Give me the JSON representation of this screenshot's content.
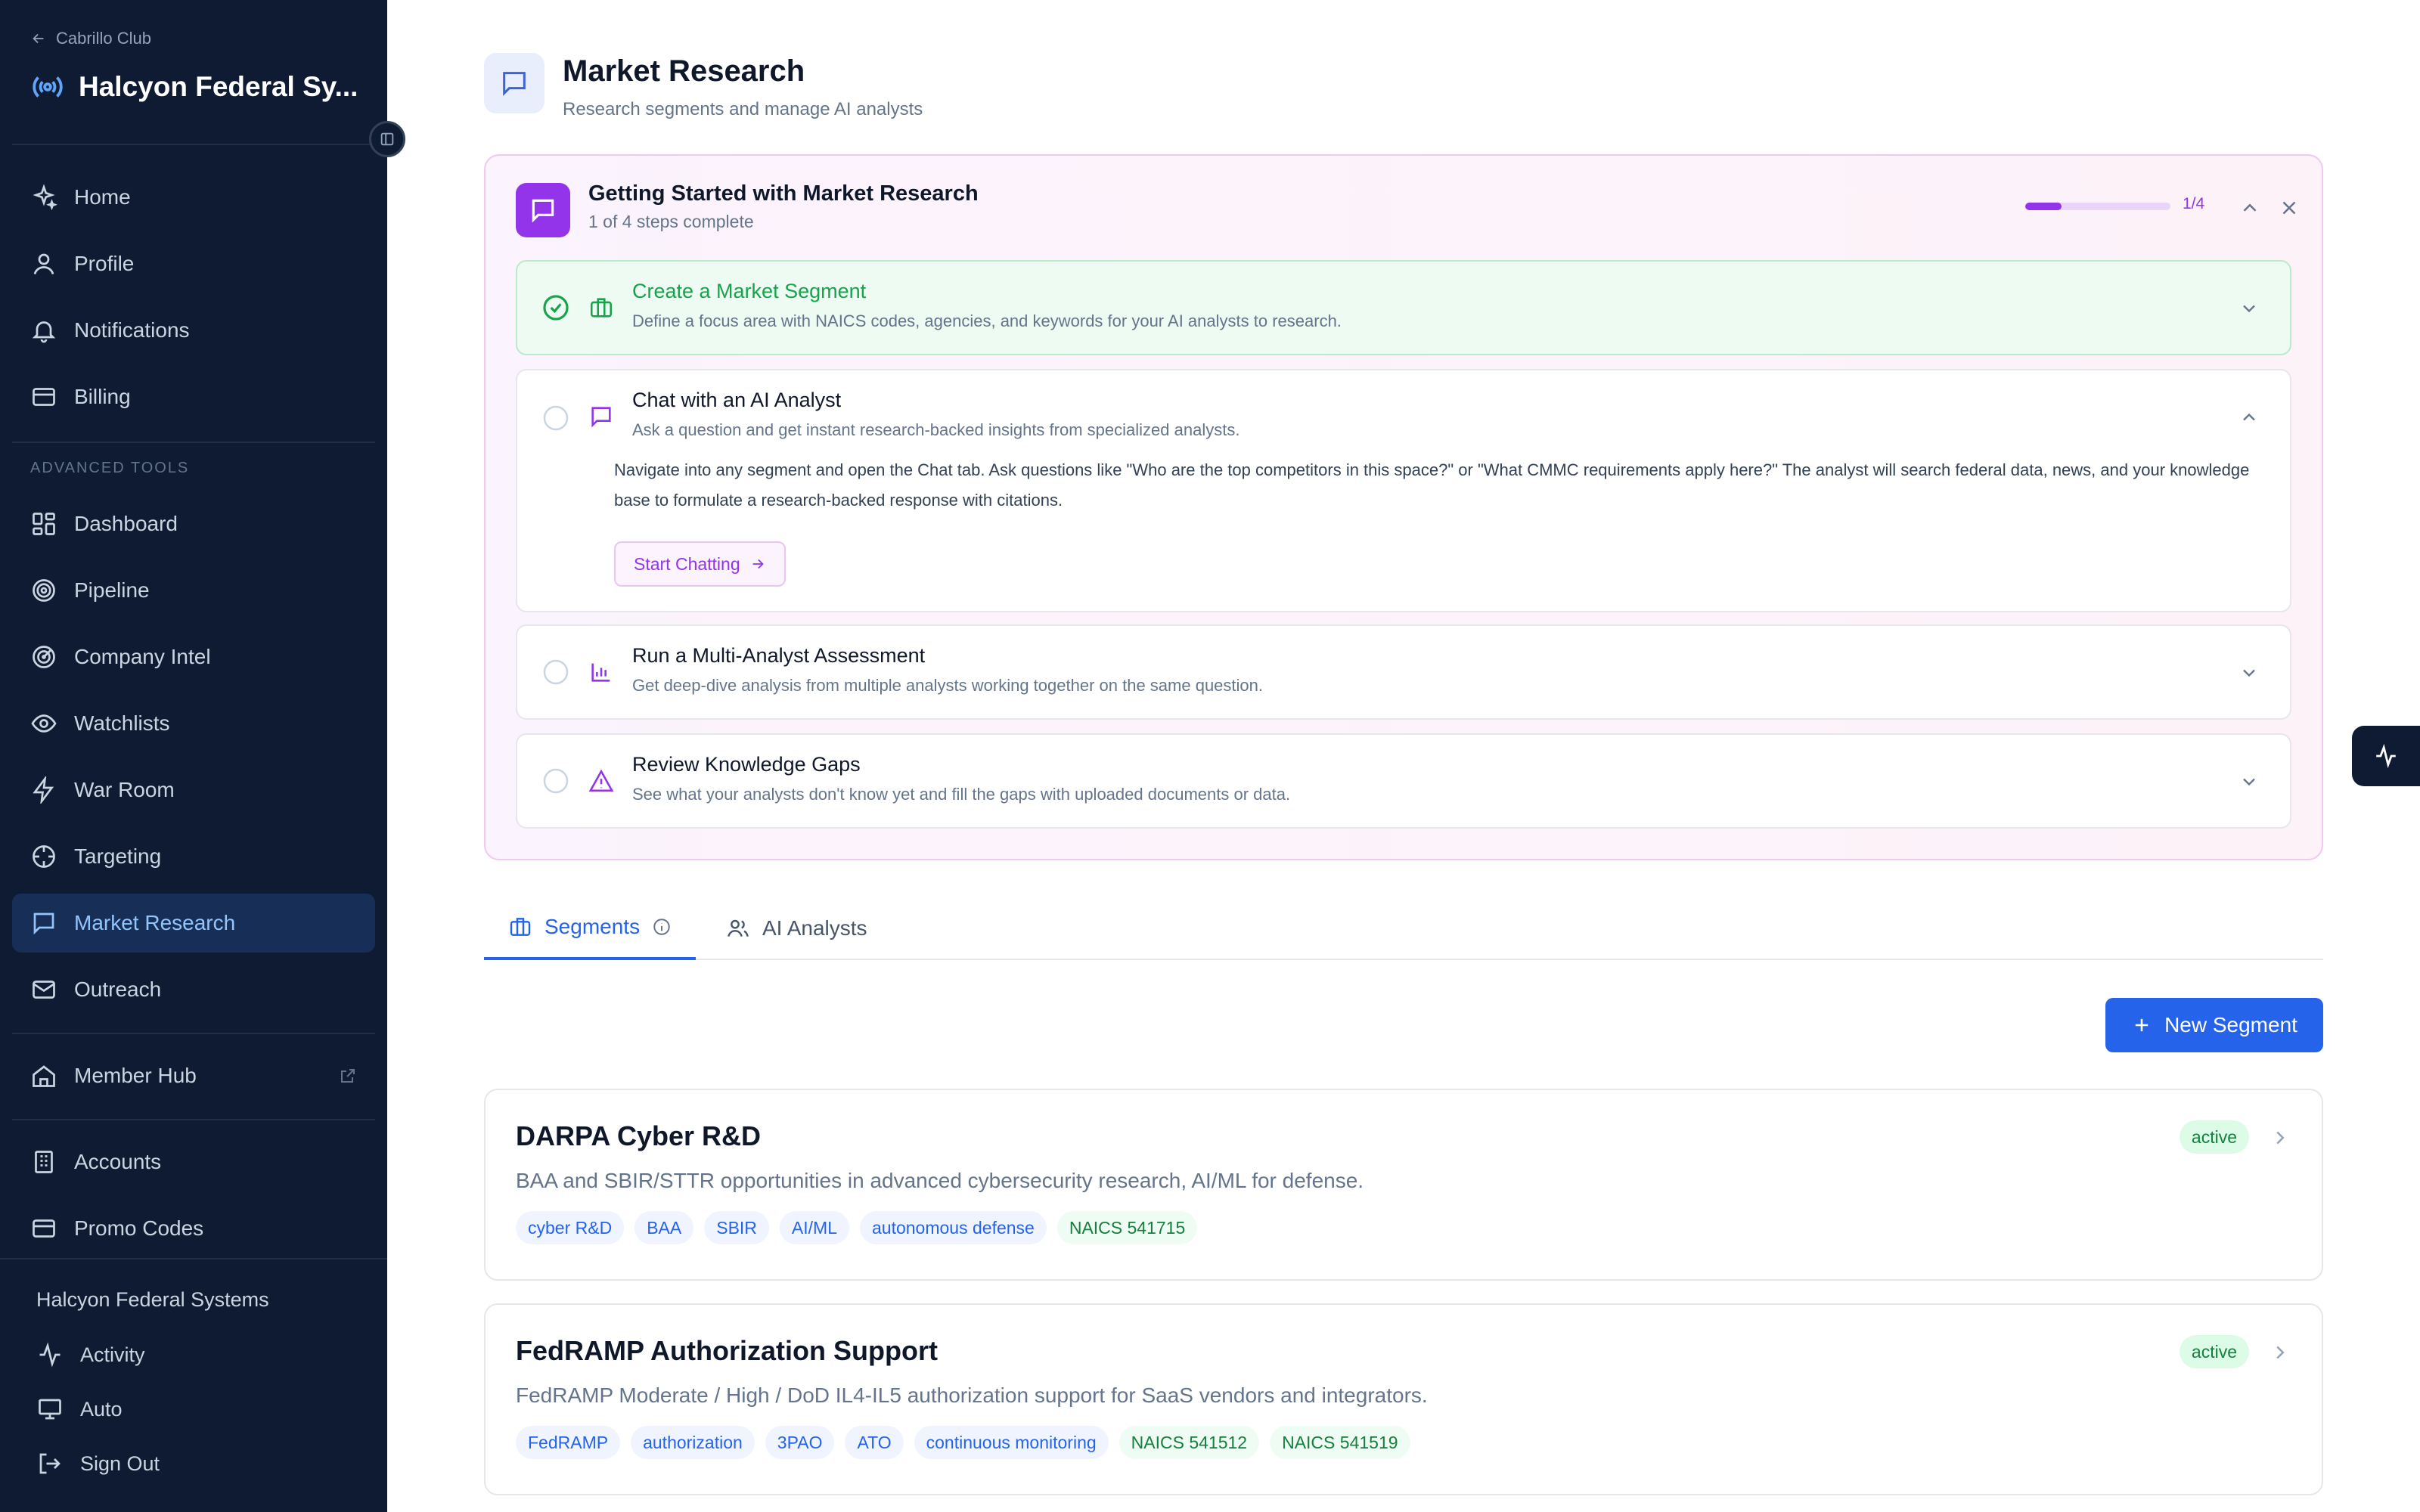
{
  "sidebar": {
    "back_label": "Cabrillo Club",
    "org_name": "Halcyon Federal Sy...",
    "primary_items": [
      {
        "label": "Home",
        "icon": "sparkle-icon"
      },
      {
        "label": "Profile",
        "icon": "user-icon"
      },
      {
        "label": "Notifications",
        "icon": "bell-icon"
      },
      {
        "label": "Billing",
        "icon": "credit-card-icon"
      }
    ],
    "section_label": "ADVANCED TOOLS",
    "advanced_items": [
      {
        "label": "Dashboard",
        "icon": "dashboard-icon"
      },
      {
        "label": "Pipeline",
        "icon": "target-icon"
      },
      {
        "label": "Company Intel",
        "icon": "radar-icon"
      },
      {
        "label": "Watchlists",
        "icon": "eye-icon"
      },
      {
        "label": "War Room",
        "icon": "bolt-icon"
      },
      {
        "label": "Targeting",
        "icon": "crosshair-icon"
      },
      {
        "label": "Market Research",
        "icon": "chat-icon",
        "active": true
      },
      {
        "label": "Outreach",
        "icon": "mail-icon"
      }
    ],
    "member_hub": "Member Hub",
    "admin_items": [
      {
        "label": "Accounts",
        "icon": "building-icon"
      },
      {
        "label": "Promo Codes",
        "icon": "credit-card-icon"
      }
    ],
    "footer": {
      "org_full": "Halcyon Federal Systems",
      "activity": "Activity",
      "theme": "Auto",
      "sign_out": "Sign Out"
    }
  },
  "page": {
    "title": "Market Research",
    "subtitle": "Research segments and manage AI analysts"
  },
  "getting_started": {
    "title": "Getting Started with Market Research",
    "subtitle": "1 of 4 steps complete",
    "progress_label": "1/4",
    "progress_fraction": 0.25,
    "accent_color": "#9333ea",
    "steps": [
      {
        "title": "Create a Market Segment",
        "desc": "Define a focus area with NAICS codes, agencies, and keywords for your AI analysts to research.",
        "done": true
      },
      {
        "title": "Chat with an AI Analyst",
        "desc": "Ask a question and get instant research-backed insights from specialized analysts.",
        "done": false,
        "body": "Navigate into any segment and open the Chat tab. Ask questions like \"Who are the top competitors in this space?\" or \"What CMMC requirements apply here?\" The analyst will search federal data, news, and your knowledge base to formulate a research-backed response with citations.",
        "button": "Start Chatting"
      },
      {
        "title": "Run a Multi-Analyst Assessment",
        "desc": "Get deep-dive analysis from multiple analysts working together on the same question.",
        "done": false
      },
      {
        "title": "Review Knowledge Gaps",
        "desc": "See what your analysts don't know yet and fill the gaps with uploaded documents or data.",
        "done": false
      }
    ]
  },
  "tabs": [
    {
      "label": "Segments",
      "active": true
    },
    {
      "label": "AI Analysts",
      "active": false
    }
  ],
  "new_segment_label": "New Segment",
  "segments": [
    {
      "title": "DARPA Cyber R&D",
      "desc": "BAA and SBIR/STTR opportunities in advanced cybersecurity research, AI/ML for defense.",
      "status": "active",
      "tags": [
        "cyber R&D",
        "BAA",
        "SBIR",
        "AI/ML",
        "autonomous defense"
      ],
      "naics": [
        "NAICS 541715"
      ]
    },
    {
      "title": "FedRAMP Authorization Support",
      "desc": "FedRAMP Moderate / High / DoD IL4-IL5 authorization support for SaaS vendors and integrators.",
      "status": "active",
      "tags": [
        "FedRAMP",
        "authorization",
        "3PAO",
        "ATO",
        "continuous monitoring"
      ],
      "naics": [
        "NAICS 541512",
        "NAICS 541519"
      ]
    }
  ],
  "colors": {
    "sidebar_bg": "#0f1b33",
    "primary": "#2563eb",
    "success": "#16a34a"
  }
}
